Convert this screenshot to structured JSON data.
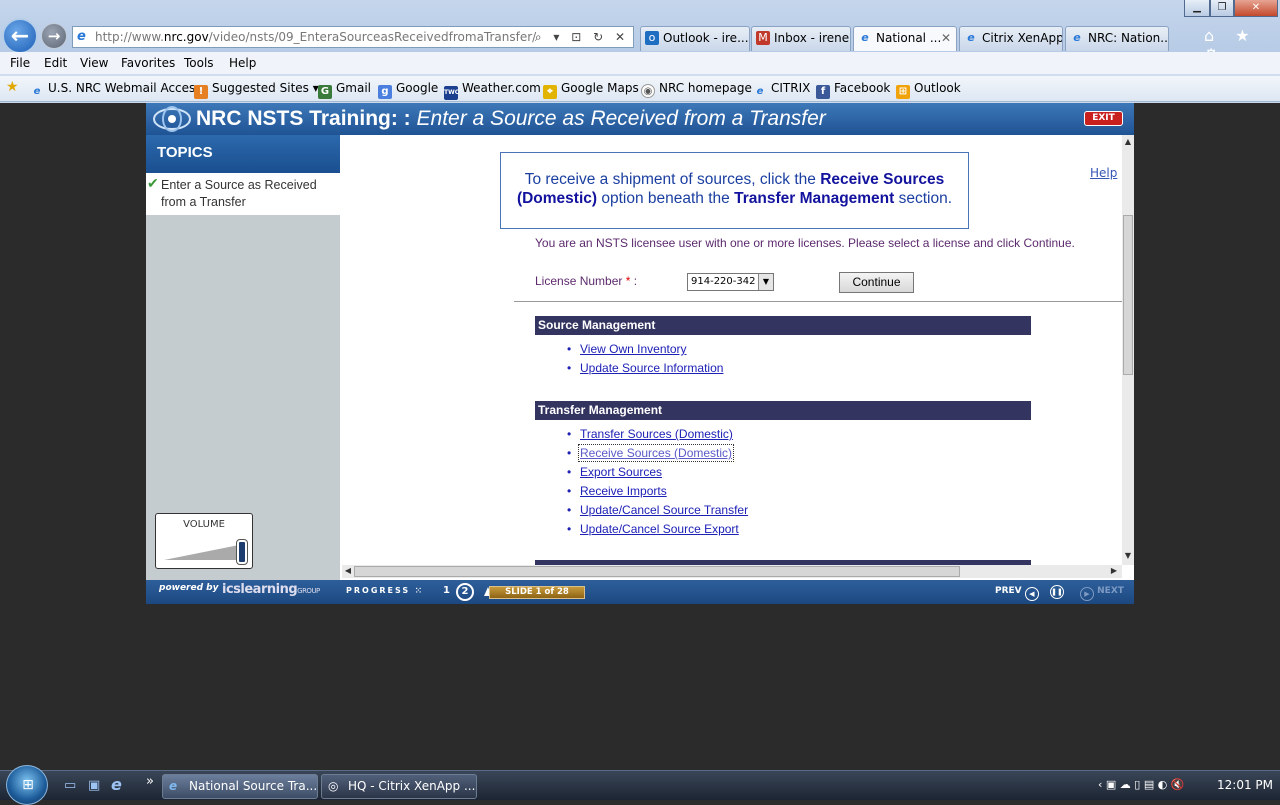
{
  "browser": {
    "address": {
      "prefix": "http://www.",
      "domain": "nrc.gov",
      "path": "/video/nsts/09_EnteraSourceasReceivedfromaTransfer/"
    },
    "address_tools": "⌕ ▾ ⊡ ↻ ✕",
    "tabs": [
      {
        "label": "Outlook - ire...",
        "icon": "outlook-icon"
      },
      {
        "label": "Inbox - irene...",
        "icon": "gmail-icon"
      },
      {
        "label": "National ...",
        "icon": "ie-icon",
        "active": true
      },
      {
        "label": "Citrix XenApp...",
        "icon": "ie-icon"
      },
      {
        "label": "NRC: Nation...",
        "icon": "ie-icon"
      }
    ],
    "tab_close": "✕",
    "tool_icons": "⌂ ★ ⚙",
    "menu": [
      "File",
      "Edit",
      "View",
      "Favorites",
      "Tools",
      "Help"
    ],
    "favorites": [
      {
        "label": "U.S. NRC Webmail Access",
        "icon": "ie-icon",
        "color": "#2a79d8"
      },
      {
        "label": "Suggested Sites ▾",
        "icon": "suggested-sites-icon",
        "color": "#e67e22"
      },
      {
        "label": "Gmail",
        "icon": "gmail-icon",
        "color": "#c0392b"
      },
      {
        "label": "Google",
        "icon": "google-icon",
        "color": "#4a7fe0"
      },
      {
        "label": "Weather.com",
        "icon": "weather-icon",
        "color": "#1d3f8f"
      },
      {
        "label": "Google Maps",
        "icon": "maps-icon",
        "color": "#e2b400"
      },
      {
        "label": "NRC homepage",
        "icon": "nrc-seal-icon",
        "color": "#777777"
      },
      {
        "label": "CITRIX",
        "icon": "ie-icon",
        "color": "#2a79d8"
      },
      {
        "label": "Facebook",
        "icon": "facebook-icon",
        "color": "#3b5998"
      },
      {
        "label": "Outlook",
        "icon": "windows-icon",
        "color": "#f0a30a"
      }
    ],
    "window_buttons": {
      "minimize": "▁",
      "maximize": "❐",
      "close": "✕"
    }
  },
  "player": {
    "title": "NRC NSTS Training: :",
    "subtitle": "Enter a Source as Received from a Transfer",
    "exit": "EXIT",
    "topics_heading": "TOPICS",
    "topic_item": "Enter a Source as Received from a Transfer",
    "check": "✔",
    "volume_label": "VOLUME",
    "footer": {
      "powered_by": "powered by",
      "brand": "icslearning",
      "brand_suffix": "GROUP",
      "progress_label": "PROGRESS",
      "progress_dots": "⁙",
      "step_1": "1",
      "step_2": "2",
      "slide_counter": "SLIDE 1 of 28",
      "prev": "PREV",
      "next": "NEXT",
      "prev_symbol": "◀",
      "pause_symbol": "❚❚",
      "next_symbol": "▶"
    }
  },
  "content": {
    "callout_pre": "To receive a shipment of sources, click the ",
    "callout_bold1": "Receive Sources (Domestic)",
    "callout_mid": " option beneath the ",
    "callout_bold2": "Transfer Management",
    "callout_post": " section.",
    "help": "Help",
    "intro": "You are an NSTS licensee user with one or more licenses. Please select a license and click Continue.",
    "license_label": "License Number",
    "required_mark": "*",
    "license_colon": " :",
    "license_value": "914-220-342",
    "dropdown_arrow": "▼",
    "continue": "Continue",
    "source_management": {
      "heading": "Source Management",
      "links": [
        "View Own Inventory",
        "Update Source Information"
      ]
    },
    "transfer_management": {
      "heading": "Transfer Management",
      "links": [
        "Transfer Sources (Domestic)",
        "Receive Sources (Domestic)",
        "Export Sources",
        "Receive Imports",
        "Update/Cancel Source Transfer",
        "Update/Cancel Source Export"
      ],
      "focused_index": 1
    },
    "scroll_arrows": {
      "up": "▲",
      "down": "▼",
      "left": "◀",
      "right": "▶"
    }
  },
  "taskbar": {
    "start_symbol": "⊞",
    "quicklaunch": [
      "▭",
      "▣",
      "e",
      "»"
    ],
    "tasks": [
      {
        "label": "National Source Tra...",
        "icon": "ie-icon",
        "icon_glyph": "e"
      },
      {
        "label": "HQ - Citrix XenApp ...",
        "icon": "citrix-icon",
        "icon_glyph": "◎"
      }
    ],
    "tray_icons": "‹ ▣ ☁   ▯ ▤ ◐ 🔇",
    "clock": "12:01 PM"
  }
}
